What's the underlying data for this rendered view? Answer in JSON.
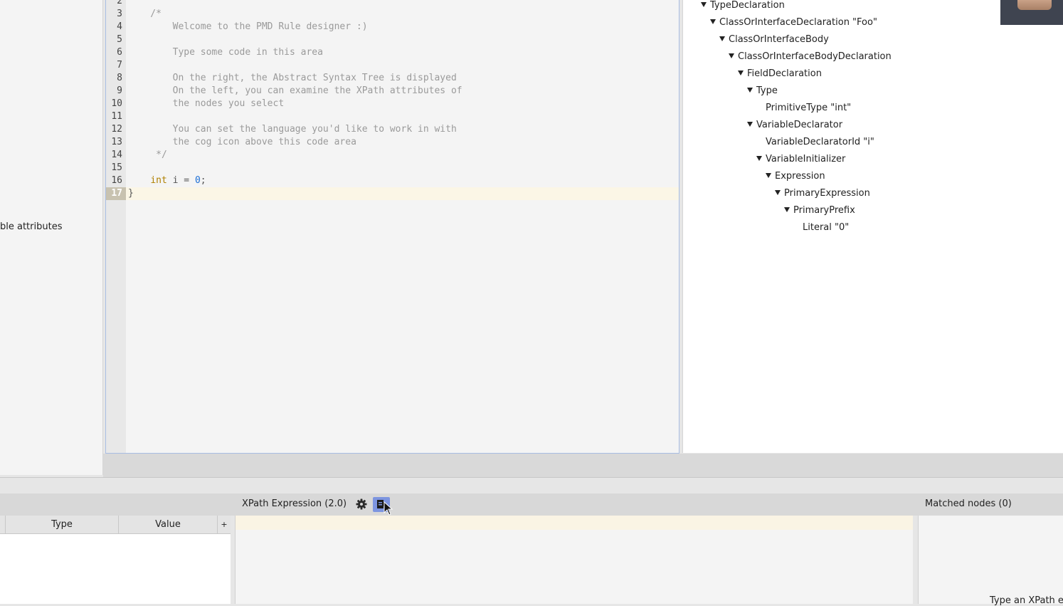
{
  "left_panel": {
    "hint_text": "ble attributes"
  },
  "editor": {
    "current_line": 17,
    "lines": [
      {
        "num": "2",
        "text": "",
        "cls": "plain"
      },
      {
        "num": "3",
        "text": "    /*",
        "cls": "comment"
      },
      {
        "num": "4",
        "text": "        Welcome to the PMD Rule designer :)",
        "cls": "comment"
      },
      {
        "num": "5",
        "text": "",
        "cls": "comment"
      },
      {
        "num": "6",
        "text": "        Type some code in this area",
        "cls": "comment"
      },
      {
        "num": "7",
        "text": "",
        "cls": "comment"
      },
      {
        "num": "8",
        "text": "        On the right, the Abstract Syntax Tree is displayed",
        "cls": "comment"
      },
      {
        "num": "9",
        "text": "        On the left, you can examine the XPath attributes of",
        "cls": "comment"
      },
      {
        "num": "10",
        "text": "        the nodes you select",
        "cls": "comment"
      },
      {
        "num": "11",
        "text": "",
        "cls": "comment"
      },
      {
        "num": "12",
        "text": "        You can set the language you'd like to work in with",
        "cls": "comment"
      },
      {
        "num": "13",
        "text": "        the cog icon above this code area",
        "cls": "comment"
      },
      {
        "num": "14",
        "text": "     */",
        "cls": "comment"
      },
      {
        "num": "15",
        "text": "",
        "cls": "plain"
      },
      {
        "num": "16",
        "text": "",
        "cls": "plain",
        "tokens": [
          {
            "t": "    ",
            "c": "plain"
          },
          {
            "t": "int",
            "c": "kw"
          },
          {
            "t": " i = ",
            "c": "plain"
          },
          {
            "t": "0",
            "c": "num"
          },
          {
            "t": ";",
            "c": "plain"
          }
        ]
      },
      {
        "num": "17",
        "text": "}",
        "cls": "plain"
      }
    ]
  },
  "ast_tree": {
    "nodes": [
      {
        "label": "TypeDeclaration",
        "depth": 0,
        "expanded": true
      },
      {
        "label": "ClassOrInterfaceDeclaration \"Foo\"",
        "depth": 1,
        "expanded": true
      },
      {
        "label": "ClassOrInterfaceBody",
        "depth": 2,
        "expanded": true
      },
      {
        "label": "ClassOrInterfaceBodyDeclaration",
        "depth": 3,
        "expanded": true
      },
      {
        "label": "FieldDeclaration",
        "depth": 4,
        "expanded": true
      },
      {
        "label": "Type",
        "depth": 5,
        "expanded": true
      },
      {
        "label": "PrimitiveType \"int\"",
        "depth": 6,
        "expanded": false
      },
      {
        "label": "VariableDeclarator",
        "depth": 5,
        "expanded": true
      },
      {
        "label": "VariableDeclaratorId \"i\"",
        "depth": 6,
        "expanded": false
      },
      {
        "label": "VariableInitializer",
        "depth": 6,
        "expanded": true
      },
      {
        "label": "Expression",
        "depth": 7,
        "expanded": true
      },
      {
        "label": "PrimaryExpression",
        "depth": 8,
        "expanded": true
      },
      {
        "label": "PrimaryPrefix",
        "depth": 9,
        "expanded": true
      },
      {
        "label": "Literal \"0\"",
        "depth": 10,
        "expanded": false
      }
    ]
  },
  "xpath_panel": {
    "title": "XPath Expression (2.0)",
    "settings_icon": "gear-icon",
    "export_icon": "export-icon",
    "expression_value": ""
  },
  "attributes_table": {
    "columns": [
      "Type",
      "Value"
    ],
    "add_column_glyph": "+"
  },
  "matched_panel": {
    "title": "Matched nodes (0)",
    "hint": "Type an XPath e"
  }
}
